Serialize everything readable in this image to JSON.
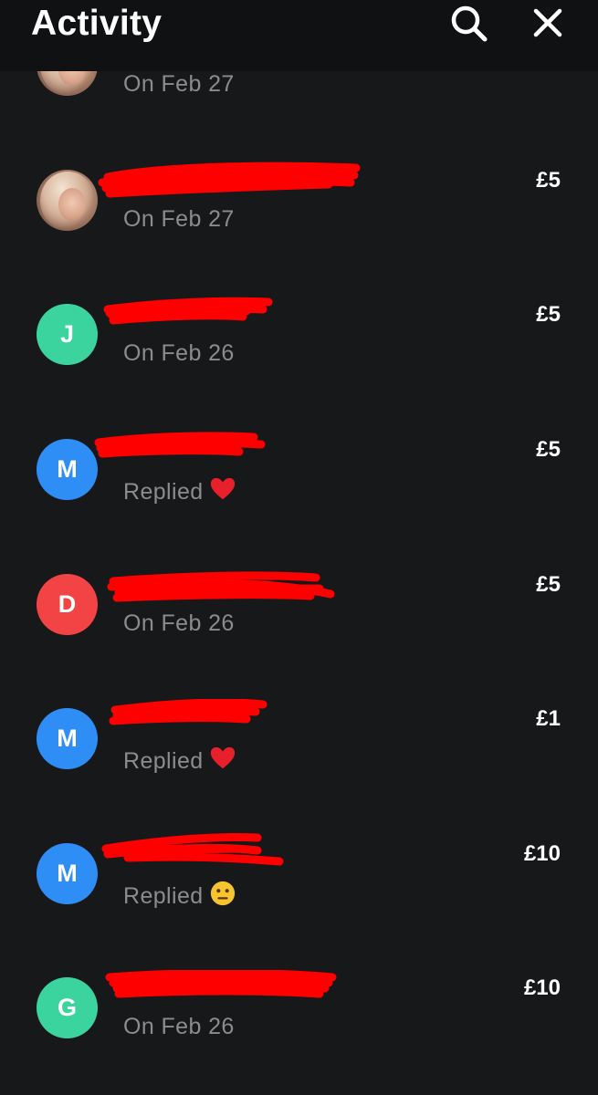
{
  "header": {
    "title": "Activity",
    "search_icon": "search-icon",
    "close_icon": "close-icon"
  },
  "colors": {
    "background": "#17181a",
    "header_background": "#101112",
    "avatar_green": "#3bd49f",
    "avatar_blue": "#2f8ef6",
    "avatar_red": "#f24345",
    "redaction": "#ff0000",
    "subtitle_gray": "#8c8c8e"
  },
  "activity": {
    "items": [
      {
        "avatar_type": "photo",
        "initial": "",
        "name": "",
        "subtitle": "On Feb 27",
        "emoji": "",
        "amount": "",
        "redacted": false
      },
      {
        "avatar_type": "photo",
        "initial": "",
        "name": "",
        "subtitle": "On Feb 27",
        "emoji": "",
        "amount": "£5",
        "redacted": true
      },
      {
        "avatar_type": "initial",
        "initial": "J",
        "avatar_color": "#3bd49f",
        "name": "",
        "subtitle": "On Feb 26",
        "emoji": "",
        "amount": "£5",
        "redacted": true
      },
      {
        "avatar_type": "initial",
        "initial": "M",
        "avatar_color": "#2f8ef6",
        "name": "",
        "subtitle": "Replied",
        "emoji": "heart-emoji",
        "amount": "£5",
        "redacted": true
      },
      {
        "avatar_type": "initial",
        "initial": "D",
        "avatar_color": "#f24345",
        "name": "",
        "subtitle": "On Feb 26",
        "emoji": "",
        "amount": "£5",
        "redacted": true
      },
      {
        "avatar_type": "initial",
        "initial": "M",
        "avatar_color": "#2f8ef6",
        "name": "",
        "subtitle": "Replied",
        "emoji": "heart-emoji",
        "amount": "£1",
        "redacted": true
      },
      {
        "avatar_type": "initial",
        "initial": "M",
        "avatar_color": "#2f8ef6",
        "name": "",
        "subtitle": "Replied",
        "emoji": "neutral-face-emoji",
        "amount": "£10",
        "redacted": true
      },
      {
        "avatar_type": "initial",
        "initial": "G",
        "avatar_color": "#3bd49f",
        "name": "",
        "subtitle": "On Feb 26",
        "emoji": "",
        "amount": "£10",
        "redacted": true
      }
    ]
  }
}
